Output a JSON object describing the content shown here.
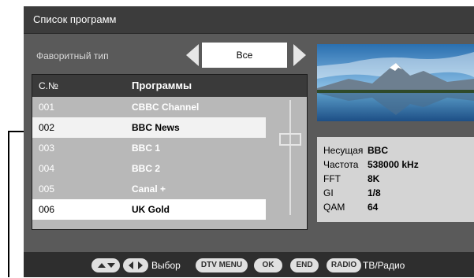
{
  "window": {
    "title": "Список программ"
  },
  "favorites": {
    "label": "Фаворитный тип",
    "value": "Все"
  },
  "list": {
    "headers": {
      "number": "C.№",
      "programs": "Программы"
    },
    "rows": [
      {
        "num": "001",
        "name": "CBBC Channel"
      },
      {
        "num": "002",
        "name": "BBC News"
      },
      {
        "num": "003",
        "name": "BBC 1"
      },
      {
        "num": "004",
        "name": "BBC 2"
      },
      {
        "num": "005",
        "name": "Canal +"
      },
      {
        "num": "006",
        "name": "UK Gold"
      }
    ]
  },
  "info": {
    "carrier": {
      "label": "Несущая",
      "value": "BBC"
    },
    "frequency": {
      "label": "Частота",
      "value": "538000 kHz"
    },
    "fft": {
      "label": "FFT",
      "value": "8K"
    },
    "gi": {
      "label": "GI",
      "value": "1/8"
    },
    "qam": {
      "label": "QAM",
      "value": "64"
    }
  },
  "footer": {
    "select_label": "Выбор",
    "dtv_menu": "DTV MENU",
    "ok": "OK",
    "end": "END",
    "radio": "RADIO",
    "tv_radio_label": "ТВ/Радио"
  },
  "colors": {
    "highlight": "#f2f2f2",
    "selected": "#ffffff",
    "frame": "#5a5a5a"
  }
}
